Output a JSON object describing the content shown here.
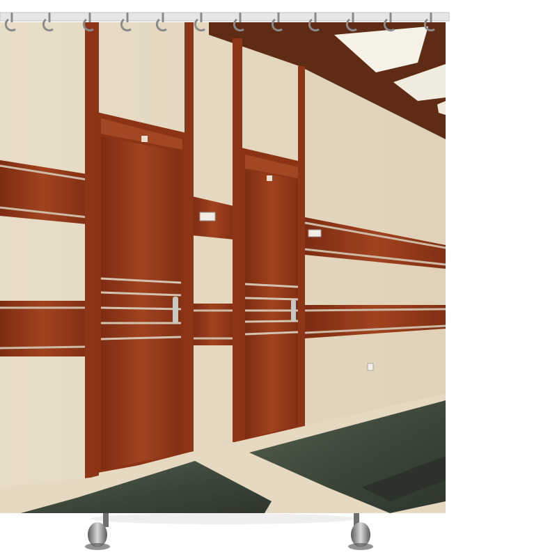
{
  "image": {
    "subject": "shower-curtain",
    "ring_count": 12
  },
  "colors": {
    "wall": "#e6dac4",
    "wood": "#8f3519",
    "wood_light": "#b0502a",
    "trim": "#c9b9a6",
    "floor_marble": "#3f4a3f",
    "floor_light": "#e9dcc6",
    "ceiling": "#5a2a14",
    "ceiling_light": "#f7f3ea",
    "rod": "#d9d9d9",
    "ring": "#8a8a8a",
    "weight": "#7a7a7a"
  }
}
